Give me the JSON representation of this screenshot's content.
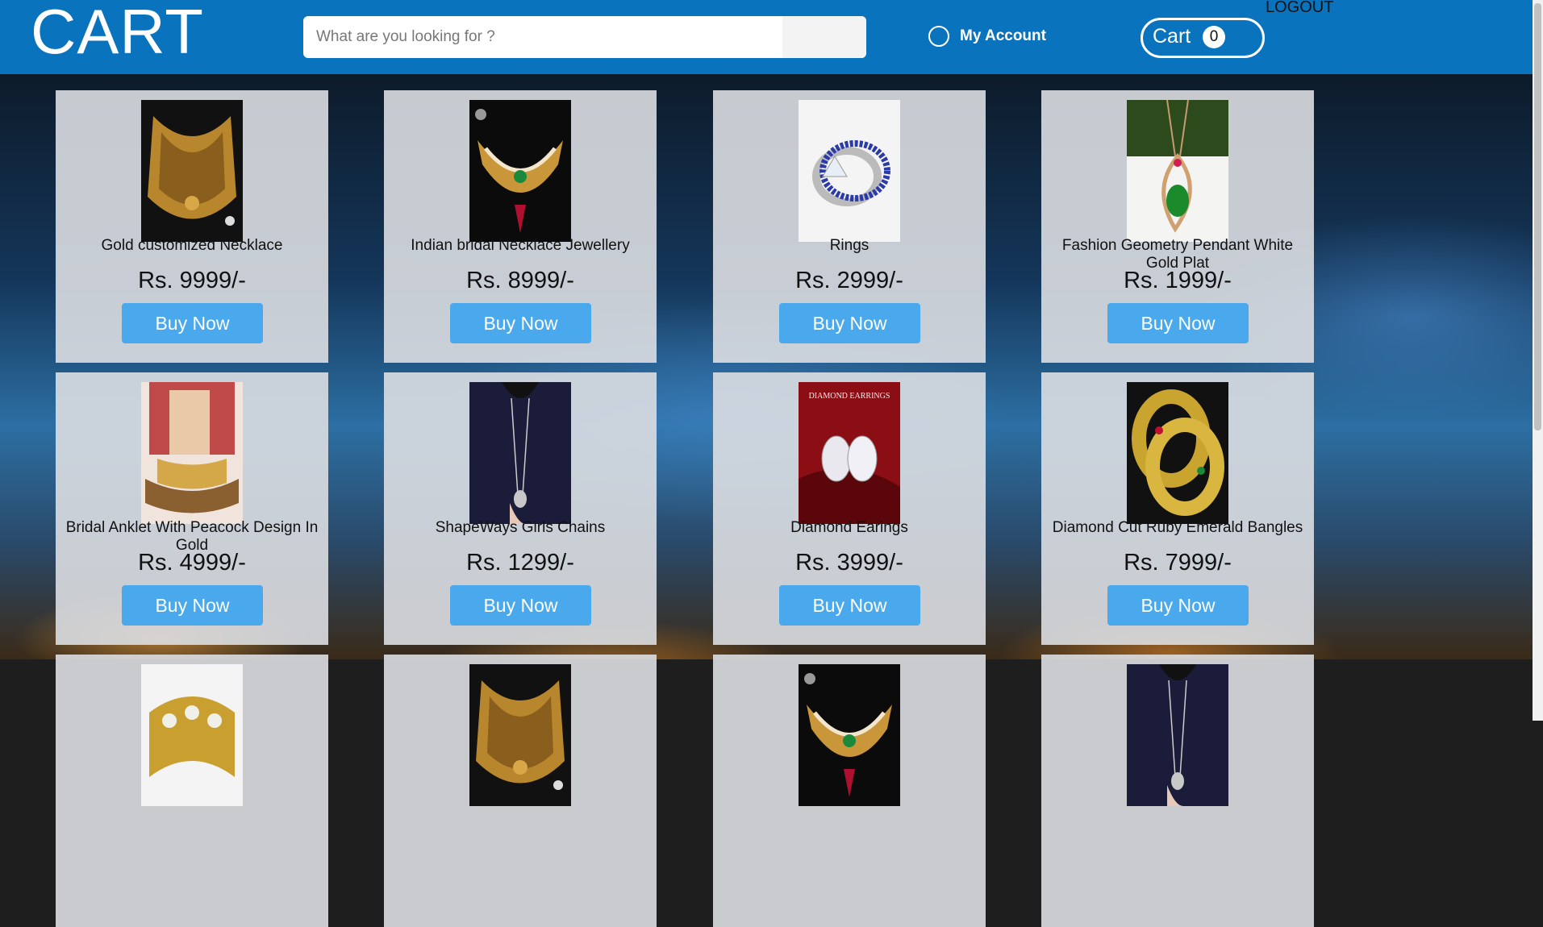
{
  "header": {
    "logo": "CART",
    "search_placeholder": "What are you looking for ?",
    "account_label": "My Account",
    "cart_label": "Cart",
    "cart_count": "0",
    "logout_label": "LOGOUT"
  },
  "products": [
    {
      "name": "Gold customized Necklace",
      "price": "Rs. 9999/-",
      "buy_label": "Buy Now",
      "icon": "gold-necklace-image"
    },
    {
      "name": "Indian bridal Necklace Jewellery",
      "price": "Rs. 8999/-",
      "buy_label": "Buy Now",
      "icon": "bridal-necklace-image"
    },
    {
      "name": "Rings",
      "price": "Rs. 2999/-",
      "buy_label": "Buy Now",
      "icon": "rings-image"
    },
    {
      "name": "Fashion Geometry Pendant White Gold Plat",
      "price": "Rs. 1999/-",
      "buy_label": "Buy Now",
      "icon": "pendant-image"
    },
    {
      "name": "Bridal Anklet With Peacock Design In Gold",
      "price": "Rs. 4999/-",
      "buy_label": "Buy Now",
      "icon": "anklet-image"
    },
    {
      "name": "ShapeWays Girls Chains",
      "price": "Rs. 1299/-",
      "buy_label": "Buy Now",
      "icon": "chain-image"
    },
    {
      "name": "Diamond Earings",
      "price": "Rs. 3999/-",
      "buy_label": "Buy Now",
      "icon": "earrings-image"
    },
    {
      "name": "Diamond Cut Ruby Emerald Bangles",
      "price": "Rs. 7999/-",
      "buy_label": "Buy Now",
      "icon": "bangles-image"
    },
    {
      "name": "",
      "price": "",
      "buy_label": "",
      "icon": "kundan-bangle-image"
    },
    {
      "name": "",
      "price": "",
      "buy_label": "",
      "icon": "gold-necklace-image"
    },
    {
      "name": "",
      "price": "",
      "buy_label": "",
      "icon": "bridal-necklace-image"
    },
    {
      "name": "",
      "price": "",
      "buy_label": "",
      "icon": "chain-image"
    }
  ],
  "colors": {
    "header_bg": "#0a73bd",
    "button_bg": "#4aa8ec",
    "card_bg": "#dcdee2"
  }
}
